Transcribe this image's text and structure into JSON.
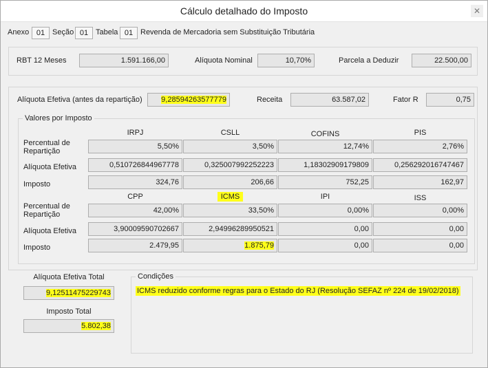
{
  "window": {
    "title": "Cálculo detalhado do Imposto",
    "close_symbol": "✕"
  },
  "header": {
    "anexo_label": "Anexo",
    "anexo_value": "01",
    "secao_label": "Seção",
    "secao_value": "01",
    "tabela_label": "Tabela",
    "tabela_value": "01",
    "description": "Revenda de Mercadoria sem Substituição Tributária"
  },
  "summary": {
    "rbt_label": "RBT 12 Meses",
    "rbt_value": "1.591.166,00",
    "aliq_nominal_label": "Alíquota Nominal",
    "aliq_nominal_value": "10,70%",
    "parcela_label": "Parcela a Deduzir",
    "parcela_value": "22.500,00"
  },
  "effective": {
    "aliq_label": "Alíquota Efetiva (antes da repartição)",
    "aliq_value": "9,28594263577779",
    "receita_label": "Receita",
    "receita_value": "63.587,02",
    "fator_label": "Fator R",
    "fator_value": "0,75"
  },
  "valores": {
    "title": "Valores por Imposto",
    "row_labels": {
      "percentual_line1": "Percentual de",
      "percentual_line2": "Repartição",
      "aliquota": "Alíquota Efetiva",
      "imposto": "Imposto"
    },
    "top": {
      "headers": [
        "IRPJ",
        "CSLL",
        "COFINS",
        "PIS"
      ],
      "percentual": [
        "5,50%",
        "3,50%",
        "12,74%",
        "2,76%"
      ],
      "aliquota": [
        "0,510726844967778",
        "0,325007992252223",
        "1,18302909179809",
        "0,256292016747467"
      ],
      "imposto": [
        "324,76",
        "206,66",
        "752,25",
        "162,97"
      ]
    },
    "bottom": {
      "headers": [
        "CPP",
        "ICMS",
        "IPI",
        "ISS"
      ],
      "percentual": [
        "42,00%",
        "33,50%",
        "0,00%",
        "0,00%"
      ],
      "aliquota": [
        "3,90009590702667",
        "2,94996289950521",
        "0,00",
        "0,00"
      ],
      "imposto": [
        "2.479,95",
        "1.875,79",
        "0,00",
        "0,00"
      ]
    }
  },
  "totals": {
    "aliq_total_label": "Alíquota Efetiva Total",
    "aliq_total_value": "9,12511475229743",
    "imposto_total_label": "Imposto Total",
    "imposto_total_value": "5.802,38"
  },
  "condicoes": {
    "title": "Condições",
    "text": "ICMS reduzido conforme regras para o Estado do RJ (Resolução SEFAZ nº 224 de 19/02/2018)"
  },
  "colors": {
    "highlight": "#ffff1a",
    "box_fill": "#e6e6e6",
    "window_bg": "#f0f0f0"
  }
}
